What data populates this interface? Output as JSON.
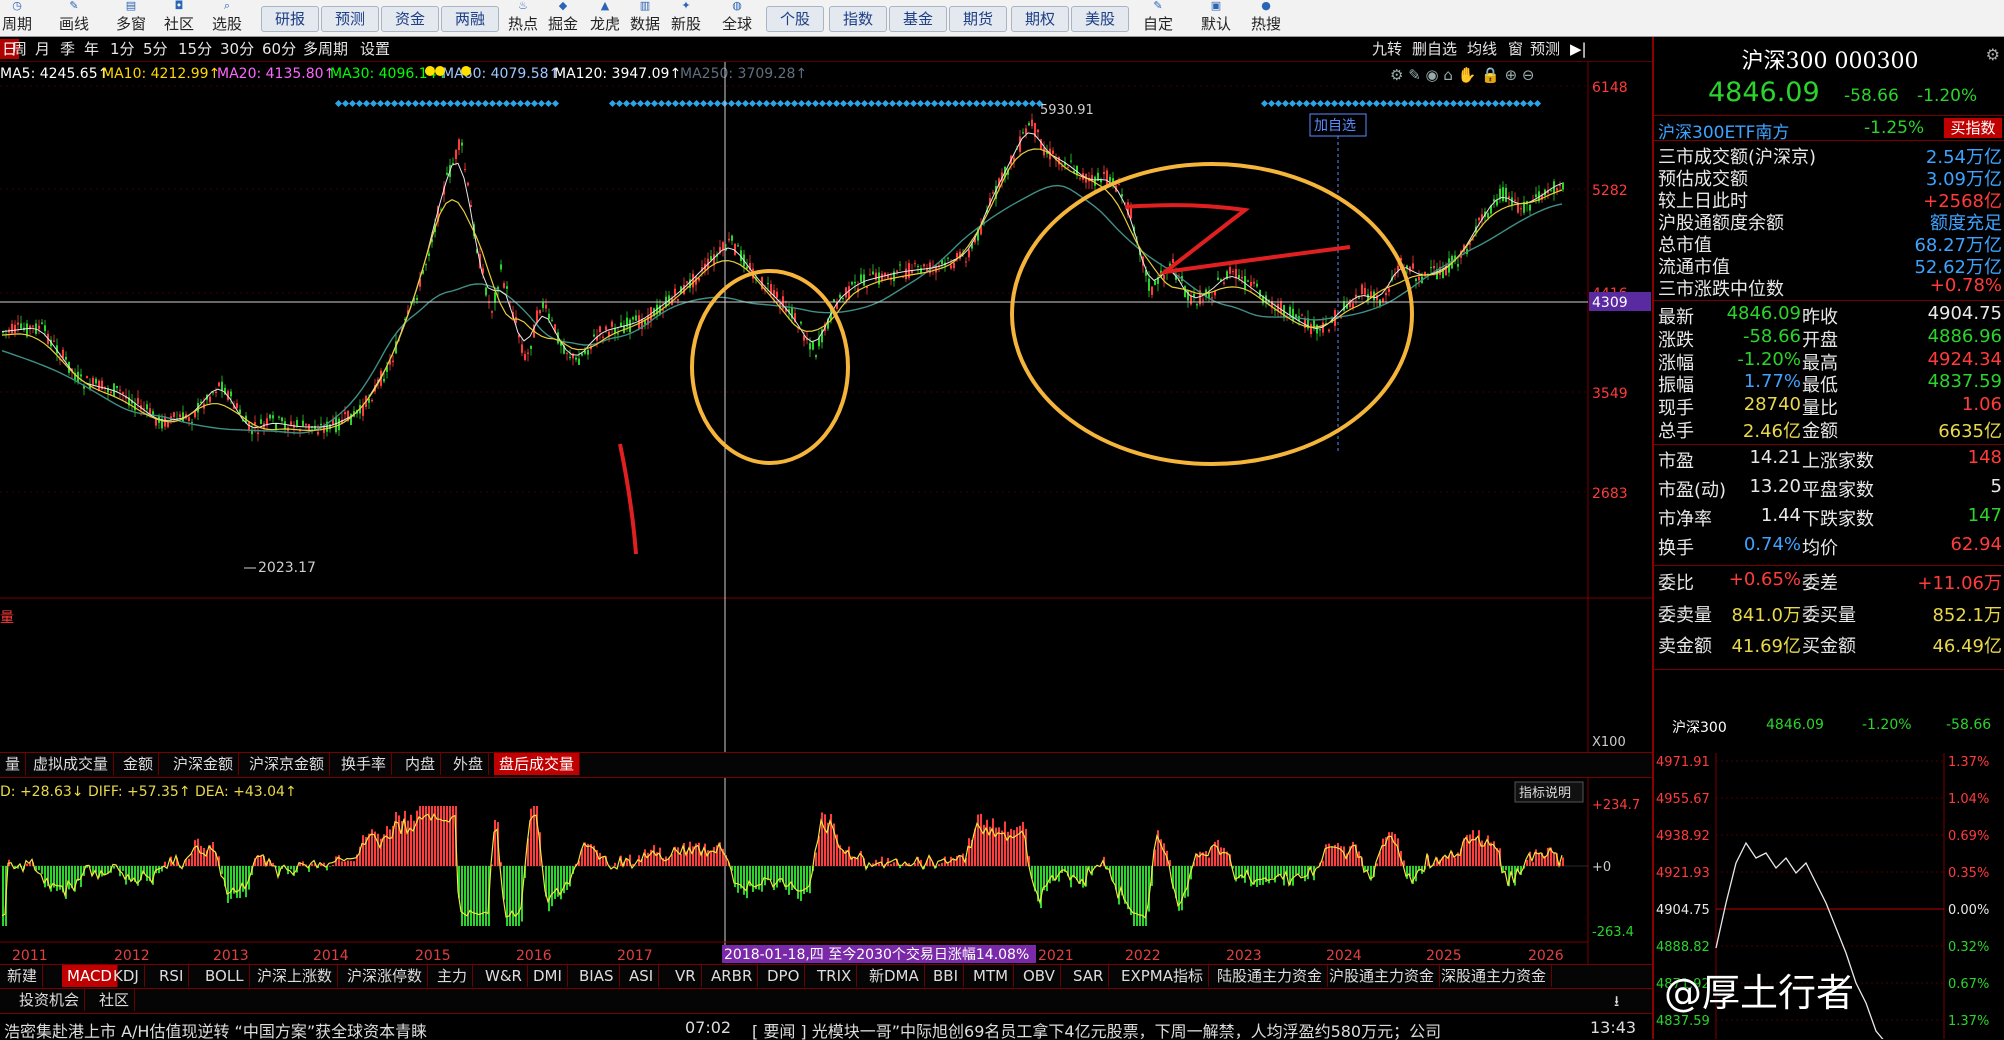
{
  "toolbar": {
    "items_left": [
      "周期",
      "画线",
      "多窗",
      "社区",
      "选股"
    ],
    "buttons": [
      "研报",
      "预测",
      "资金",
      "两融"
    ],
    "items_mid": [
      "热点",
      "掘金",
      "龙虎",
      "数据",
      "新股",
      "全球"
    ],
    "buttons2": [
      "个股",
      "指数",
      "基金",
      "期货",
      "期权",
      "美股"
    ],
    "items_right": [
      "自定",
      "默认",
      "热搜"
    ]
  },
  "period": {
    "items": [
      "日",
      "周",
      "月",
      "季",
      "年",
      "1分",
      "5分",
      "15分",
      "30分",
      "60分",
      "多周期",
      "设置"
    ],
    "right_items": [
      "九转",
      "删自选",
      "均线",
      "窗",
      "预测"
    ]
  },
  "ma_legend": [
    {
      "text": "MA5: 4245.65↑",
      "color": "#ffffff"
    },
    {
      "text": "MA10: 4212.99↑",
      "color": "#ffd700"
    },
    {
      "text": "MA20: 4135.80↑",
      "color": "#ff66ff"
    },
    {
      "text": "MA30: 4096.14↑",
      "color": "#00ff00"
    },
    {
      "text": "MA60: 4079.58↑",
      "color": "#9ec7ff"
    },
    {
      "text": "MA120: 3947.09↑",
      "color": "#ffffff"
    },
    {
      "text": "MA250: 3709.28↑",
      "color": "#607080"
    }
  ],
  "price_axis": [
    "6148",
    "5282",
    "4416",
    "3549",
    "2683"
  ],
  "cursor_price": "4309",
  "annotations": {
    "high": "5930.91",
    "low": "2023.17",
    "add_watch": "加自选"
  },
  "volume_label": "X100",
  "volume_tag": "量",
  "tabs1": [
    "量",
    "虚拟成交量",
    "金额",
    "沪深金额",
    "沪深京金额",
    "换手率",
    "内盘",
    "外盘",
    "盘后成交量"
  ],
  "macd_legend": "D: +28.63↓  DIFF: +57.35↑  DEA: +43.04↑",
  "macd_help": "指标说明",
  "macd_axis": [
    "+234.7",
    "+0",
    "-263.4"
  ],
  "years": [
    "2011",
    "2012",
    "2013",
    "2014",
    "2015",
    "2016",
    "2017",
    "2021",
    "2022",
    "2023",
    "2024",
    "2025",
    "2026"
  ],
  "range_label": "2018-01-18,四 至今2030个交易日涨幅14.08%",
  "tabs2": [
    "新建",
    "MACD",
    "KDJ",
    "RSI",
    "BOLL",
    "沪深上涨数",
    "沪深涨停数",
    "主力",
    "W&R",
    "DMI",
    "BIAS",
    "ASI",
    "VR",
    "ARBR",
    "DPO",
    "TRIX",
    "新DMA",
    "BBI",
    "MTM",
    "OBV",
    "SAR",
    "EXPMA指标",
    "陆股通主力资金",
    "沪股通主力资金",
    "深股通主力资金"
  ],
  "tabs3": [
    "投资机会",
    "社区"
  ],
  "news": [
    {
      "text": "浩密集赴港上市 A/H估值现逆转 “中国方案”获全球资本青睐"
    },
    {
      "text": "07:02"
    },
    {
      "text": "[ 要闻 ]  光模块一哥”中际旭创69名员工拿下4亿元股票，下周一解禁，人均浮盈约580万元；公司"
    },
    {
      "text": "13:43"
    }
  ],
  "panel": {
    "title": "沪深300 000300",
    "price": "4846.09",
    "change": "-58.66",
    "change_pct": "-1.20%",
    "etf_name": "沪深300ETF南方",
    "etf_pct": "-1.25%",
    "etf_button": "买指数",
    "stats": [
      {
        "label": "三市成交额(沪深京)",
        "value": "2.54万亿",
        "vc": "#3ea3ff"
      },
      {
        "label": "预估成交额",
        "value": "3.09万亿",
        "vc": "#3ea3ff"
      },
      {
        "label": "较上日此时",
        "value": "+2568亿",
        "vc": "#ff3b3b"
      },
      {
        "label": "沪股通额度余额",
        "value": "额度充足",
        "vc": "#3ea3ff"
      },
      {
        "label": "总市值",
        "value": "68.27万亿",
        "vc": "#3ea3ff"
      },
      {
        "label": "流通市值",
        "value": "52.62万亿",
        "vc": "#3ea3ff"
      },
      {
        "label": "三市涨跌中位数",
        "value": "+0.78%",
        "vc": "#ff3b3b"
      }
    ],
    "quotes": [
      {
        "l1": "最新",
        "v1": "4846.09",
        "c1": "#2bd42b",
        "l2": "昨收",
        "v2": "4904.75",
        "c2": "#e8e8e8"
      },
      {
        "l1": "涨跌",
        "v1": "-58.66",
        "c1": "#2bd42b",
        "l2": "开盘",
        "v2": "4886.96",
        "c2": "#2bd42b"
      },
      {
        "l1": "涨幅",
        "v1": "-1.20%",
        "c1": "#2bd42b",
        "l2": "最高",
        "v2": "4924.34",
        "c2": "#ff3b3b"
      },
      {
        "l1": "振幅",
        "v1": "1.77%",
        "c1": "#3ea3ff",
        "l2": "最低",
        "v2": "4837.59",
        "c2": "#2bd42b"
      },
      {
        "l1": "现手",
        "v1": "28740",
        "c1": "#e8d84a",
        "l2": "量比",
        "v2": "1.06",
        "c2": "#ff3b3b"
      },
      {
        "l1": "总手",
        "v1": "2.46亿",
        "c1": "#e8d84a",
        "l2": "金额",
        "v2": "6635亿",
        "c2": "#e8d84a"
      }
    ],
    "quotes2": [
      {
        "l1": "市盈",
        "v1": "14.21",
        "c1": "#e8e8e8",
        "l2": "上涨家数",
        "v2": "148",
        "c2": "#ff3b3b"
      },
      {
        "l1": "市盈(动)",
        "v1": "13.20",
        "c1": "#e8e8e8",
        "l2": "平盘家数",
        "v2": "5",
        "c2": "#e8e8e8"
      },
      {
        "l1": "市净率",
        "v1": "1.44",
        "c1": "#e8e8e8",
        "l2": "下跌家数",
        "v2": "147",
        "c2": "#2bd42b"
      },
      {
        "l1": "换手",
        "v1": "0.74%",
        "c1": "#3ea3ff",
        "l2": "均价",
        "v2": "62.94",
        "c2": "#ff3b3b"
      }
    ],
    "quotes3": [
      {
        "l1": "委比",
        "v1": "+0.65%",
        "c1": "#ff3b3b",
        "l2": "委差",
        "v2": "+11.06万",
        "c2": "#ff3b3b"
      },
      {
        "l1": "委卖量",
        "v1": "841.0万",
        "c1": "#e8d84a",
        "l2": "委买量",
        "v2": "852.1万",
        "c2": "#e8d84a"
      },
      {
        "l1": "卖金额",
        "v1": "41.69亿",
        "c1": "#e8d84a",
        "l2": "买金额",
        "v2": "46.49亿",
        "c2": "#e8d84a"
      }
    ],
    "mini": {
      "name": "沪深300",
      "price": "4846.09",
      "pct": "-1.20%",
      "chg": "-58.66"
    },
    "intraday_left": [
      "4971.91",
      "4955.67",
      "4938.92",
      "4921.93",
      "4904.75",
      "4888.82",
      "4871.92",
      "4837.59"
    ],
    "intraday_right": [
      "1.37%",
      "1.04%",
      "0.69%",
      "0.35%",
      "0.00%",
      "0.32%",
      "0.67%",
      "1.37%"
    ],
    "watermark": "@厚土行者"
  },
  "colors": {
    "up": "#ff3b3b",
    "down": "#2bd42b",
    "accent": "#f5b53a",
    "grid": "#7a0000"
  }
}
